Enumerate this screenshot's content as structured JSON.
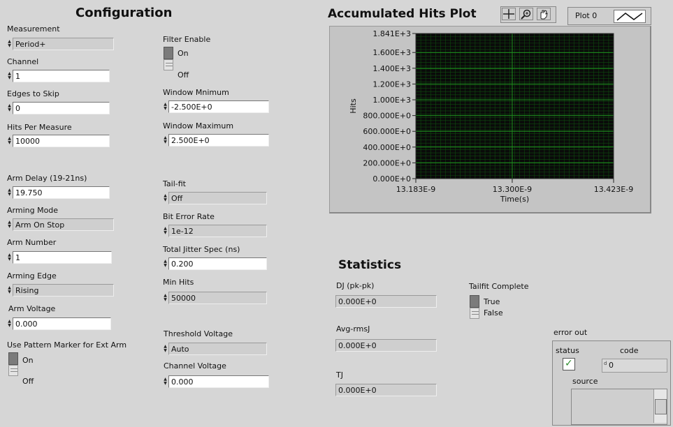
{
  "config": {
    "title": "Configuration",
    "measurement": {
      "label": "Measurement",
      "value": "Period+"
    },
    "channel": {
      "label": "Channel",
      "value": "1"
    },
    "edges_to_skip": {
      "label": "Edges to Skip",
      "value": "0"
    },
    "hits_per_measure": {
      "label": "Hits Per Measure",
      "value": "10000"
    },
    "arm_delay": {
      "label": "Arm Delay (19-21ns)",
      "value": "19.750"
    },
    "arming_mode": {
      "label": "Arming Mode",
      "value": "Arm On Stop"
    },
    "arm_number": {
      "label": "Arm Number",
      "value": "1"
    },
    "arming_edge": {
      "label": "Arming Edge",
      "value": "Rising"
    },
    "arm_voltage": {
      "label": "Arm Voltage",
      "value": "0.000"
    },
    "pattern_marker": {
      "label": "Use Pattern Marker for Ext Arm",
      "on": "On",
      "off": "Off"
    },
    "filter_enable": {
      "label": "Filter Enable",
      "on": "On",
      "off": "Off"
    },
    "window_min": {
      "label": "Window Mnimum",
      "value": "-2.500E+0"
    },
    "window_max": {
      "label": "Window Maximum",
      "value": "2.500E+0"
    },
    "tail_fit": {
      "label": "Tail-fit",
      "value": "Off"
    },
    "bit_error_rate": {
      "label": "Bit Error Rate",
      "value": "1e-12"
    },
    "total_jitter_spec": {
      "label": "Total Jitter Spec (ns)",
      "value": "0.200"
    },
    "min_hits": {
      "label": "Min Hits",
      "value": "50000"
    },
    "threshold_voltage": {
      "label": "Threshold Voltage",
      "value": "Auto"
    },
    "channel_voltage": {
      "label": "Channel Voltage",
      "value": "0.000"
    }
  },
  "plot": {
    "title": "Accumulated Hits Plot",
    "legend_label": "Plot 0",
    "tools": [
      "crosshair-icon",
      "zoom-icon",
      "hand-icon"
    ],
    "colors": {
      "background": "#0a0a0a",
      "grid_major": "#1f8f1f",
      "grid_minor": "#0f4a0f"
    }
  },
  "chart_data": {
    "type": "line",
    "title": "Accumulated Hits Plot",
    "xlabel": "Time(s)",
    "ylabel": "Hits",
    "y_ticks": [
      "0.000E+0",
      "200.000E+0",
      "400.000E+0",
      "600.000E+0",
      "800.000E+0",
      "1.000E+3",
      "1.200E+3",
      "1.400E+3",
      "1.600E+3",
      "1.841E+3"
    ],
    "x_ticks": [
      "13.183E-9",
      "13.300E-9",
      "13.423E-9"
    ],
    "xlim": [
      1.3183e-08,
      1.3423e-08
    ],
    "ylim": [
      0,
      1841
    ],
    "grid": true,
    "series": []
  },
  "stats": {
    "title": "Statistics",
    "dj": {
      "label": "DJ (pk-pk)",
      "value": "0.000E+0"
    },
    "avg_rmsj": {
      "label": "Avg-rmsJ",
      "value": "0.000E+0"
    },
    "tj": {
      "label": "TJ",
      "value": "0.000E+0"
    },
    "tailfit_complete": {
      "label": "Tailfit Complete",
      "true_label": "True",
      "false_label": "False"
    }
  },
  "error_out": {
    "title": "error out",
    "status_label": "status",
    "code_label": "code",
    "code_value": "0",
    "source_label": "source",
    "status_check": "✓"
  }
}
